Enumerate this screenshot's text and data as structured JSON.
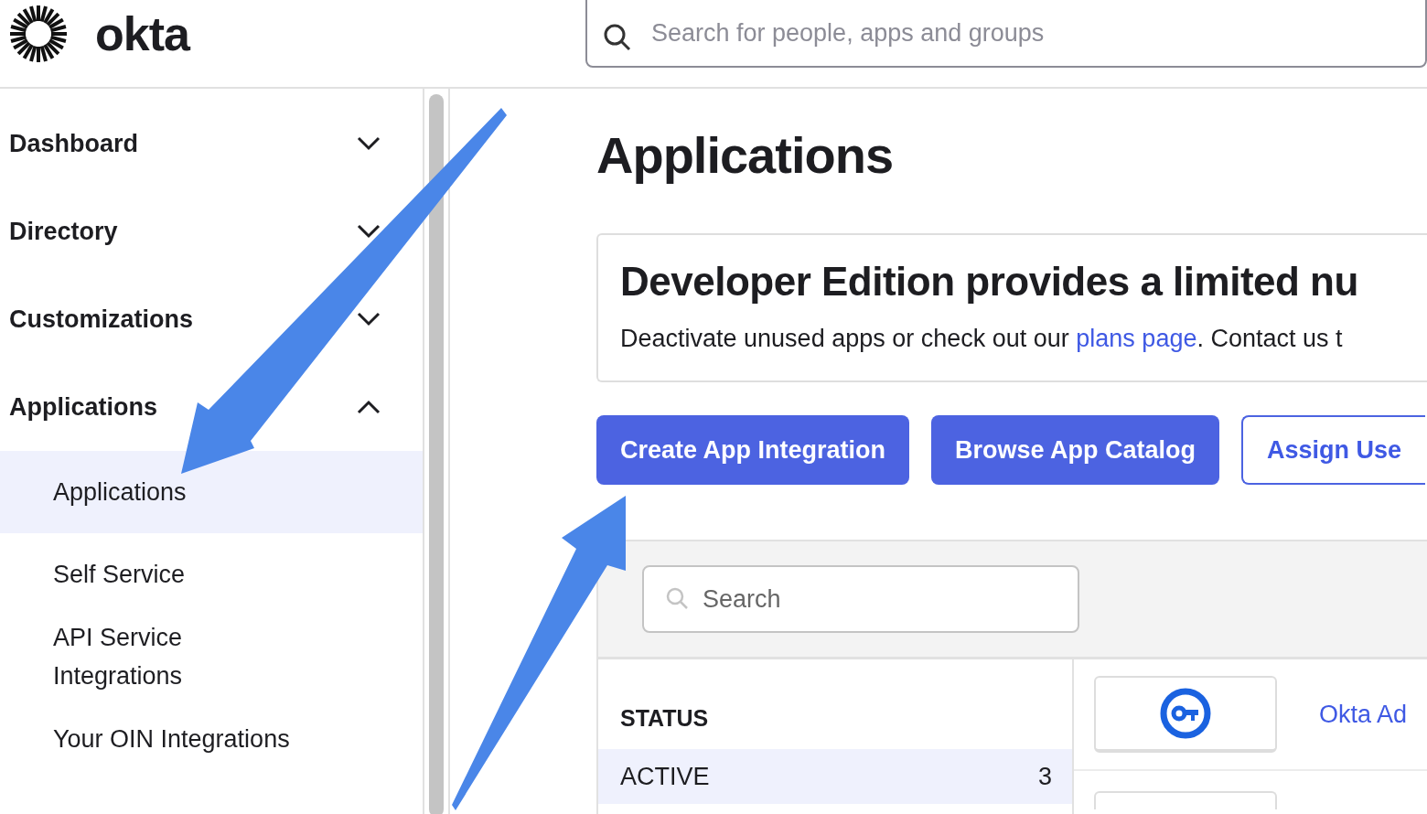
{
  "header": {
    "logo": "okta",
    "search": {
      "placeholder": "Search for people, apps and groups"
    }
  },
  "sidebar": {
    "items": [
      {
        "label": "Dashboard",
        "expanded": false
      },
      {
        "label": "Directory",
        "expanded": false
      },
      {
        "label": "Customizations",
        "expanded": false
      },
      {
        "label": "Applications",
        "expanded": true,
        "children": [
          {
            "label": "Applications",
            "selected": true
          },
          {
            "label": "Self Service",
            "selected": false
          },
          {
            "label": "API Service Integrations",
            "selected": false
          },
          {
            "label": "Your OIN Integrations",
            "selected": false
          }
        ]
      }
    ]
  },
  "main": {
    "title": "Applications",
    "notice": {
      "heading": "Developer Edition provides a limited nu",
      "text_before": "Deactivate unused apps or check out our ",
      "link": "plans page",
      "text_after": ". Contact us t"
    },
    "actions": [
      {
        "label": "Create App Integration",
        "kind": "primary"
      },
      {
        "label": "Browse App Catalog",
        "kind": "primary"
      },
      {
        "label": "Assign Use",
        "kind": "secondary"
      }
    ],
    "filter": {
      "search": {
        "placeholder": "Search"
      }
    },
    "status": {
      "heading": "STATUS",
      "options": [
        {
          "label": "ACTIVE",
          "count": "3",
          "selected": true
        }
      ]
    },
    "apps": [
      {
        "name": "Okta Ad"
      }
    ]
  }
}
